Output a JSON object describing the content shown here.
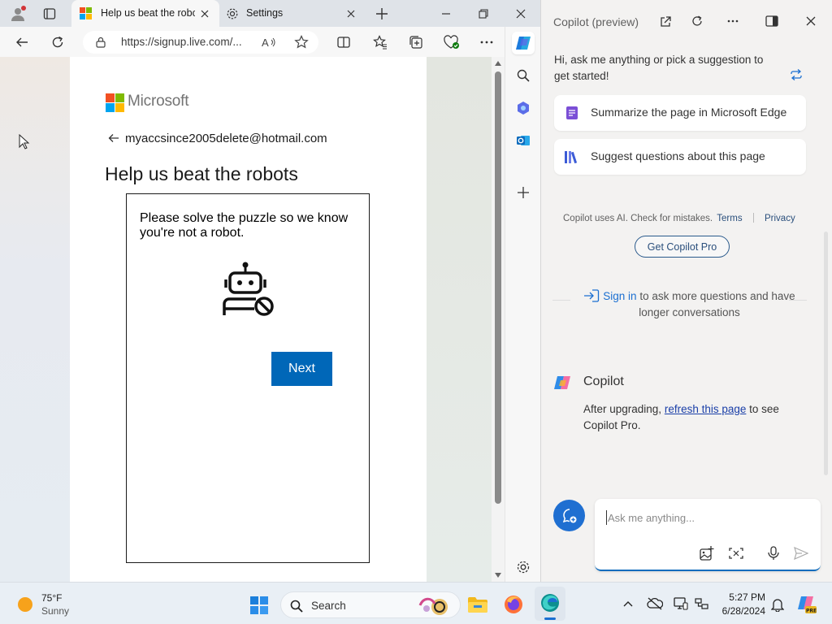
{
  "browser": {
    "tabs": [
      {
        "title": "Help us beat the robots",
        "active": true
      },
      {
        "title": "Settings",
        "active": false
      }
    ],
    "address_url": "https://signup.live.com/...",
    "window_controls": [
      "minimize",
      "restore",
      "close"
    ]
  },
  "page": {
    "brand": "Microsoft",
    "email": "myaccsince2005delete@hotmail.com",
    "heading": "Help us beat the robots",
    "puzzle_text": "Please solve the puzzle so we know you're not a robot.",
    "next_label": "Next"
  },
  "copilot": {
    "title": "Copilot (preview)",
    "greeting": "Hi, ask me anything or pick a suggestion to get started!",
    "suggestions": [
      {
        "label": "Summarize the page in Microsoft Edge",
        "icon": "document-icon"
      },
      {
        "label": "Suggest questions about this page",
        "icon": "books-icon"
      }
    ],
    "disclaimer": "Copilot uses AI. Check for mistakes.",
    "terms_link": "Terms",
    "privacy_link": "Privacy",
    "get_pro_label": "Get Copilot Pro",
    "signin_link": "Sign in",
    "signin_text": "to ask more questions and have longer conversations",
    "assistant_name": "Copilot",
    "message_prefix": "After upgrading,",
    "message_link": "refresh this page",
    "message_suffix": "to see Copilot Pro.",
    "input_placeholder": "Ask me anything..."
  },
  "taskbar": {
    "weather_temp": "75°F",
    "weather_desc": "Sunny",
    "search_label": "Search",
    "time": "5:27 PM",
    "date": "6/28/2024"
  },
  "colors": {
    "primary_button": "#0067b8",
    "copilot_accent": "#0f6cbd",
    "link": "#1a3fa8"
  }
}
